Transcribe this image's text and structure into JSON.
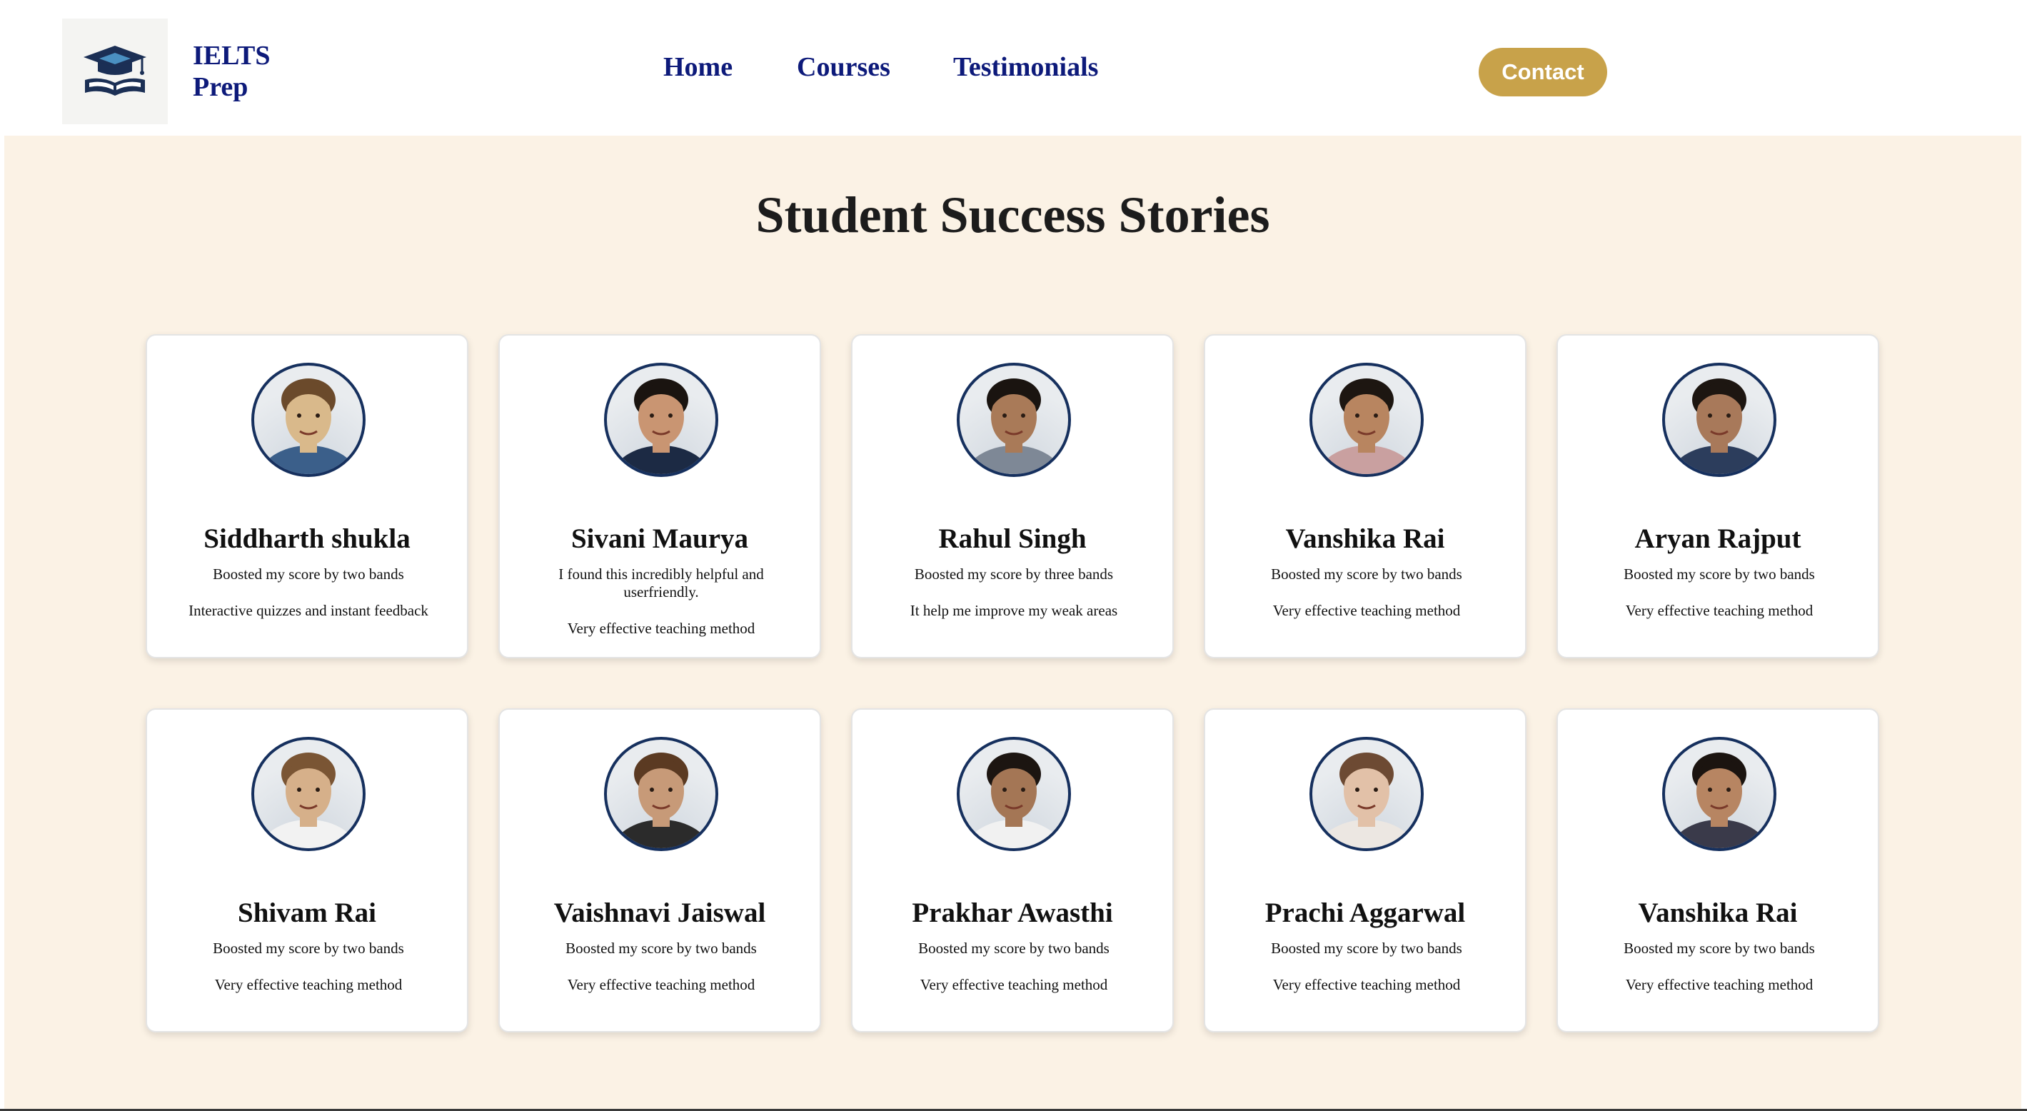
{
  "brand": {
    "logo_icon": "graduation-cap-book-icon",
    "name_line1": "IELTS",
    "name_line2": "Prep",
    "color": "#0d1a7a"
  },
  "nav": {
    "items": [
      {
        "label": "Home"
      },
      {
        "label": "Courses"
      },
      {
        "label": "Testimonials"
      }
    ],
    "contact_label": "Contact",
    "contact_color": "#c8a24a"
  },
  "section": {
    "title": "Student Success Stories",
    "background": "#fbf2e5"
  },
  "testimonials": [
    {
      "name": "Siddharth shukla",
      "line1": "Boosted my score by two bands",
      "line2": "Interactive quizzes and instant feedback",
      "avatar": "student-photo"
    },
    {
      "name": "Sivani Maurya",
      "line1": "I found this incredibly helpful and userfriendly.",
      "line2": "Very effective teaching method",
      "avatar": "student-photo"
    },
    {
      "name": "Rahul Singh",
      "line1": "Boosted my score by three bands",
      "line2": "It help me improve my weak areas",
      "avatar": "student-photo"
    },
    {
      "name": "Vanshika Rai",
      "line1": "Boosted my score by two bands",
      "line2": "Very effective teaching method",
      "avatar": "student-photo"
    },
    {
      "name": "Aryan Rajput",
      "line1": "Boosted my score by two bands",
      "line2": "Very effective teaching method",
      "avatar": "student-photo"
    },
    {
      "name": "Shivam Rai",
      "line1": "Boosted my score by two bands",
      "line2": "Very effective teaching method",
      "avatar": "student-photo"
    },
    {
      "name": "Vaishnavi Jaiswal",
      "line1": "Boosted my score by two bands",
      "line2": "Very effective teaching method",
      "avatar": "student-photo"
    },
    {
      "name": "Prakhar Awasthi",
      "line1": "Boosted my score by two bands",
      "line2": "Very effective teaching method",
      "avatar": "student-photo"
    },
    {
      "name": "Prachi Aggarwal",
      "line1": "Boosted my score by two bands",
      "line2": "Very effective teaching method",
      "avatar": "student-photo"
    },
    {
      "name": "Vanshika Rai",
      "line1": "Boosted my score by two bands",
      "line2": "Very effective teaching method",
      "avatar": "student-photo"
    }
  ]
}
